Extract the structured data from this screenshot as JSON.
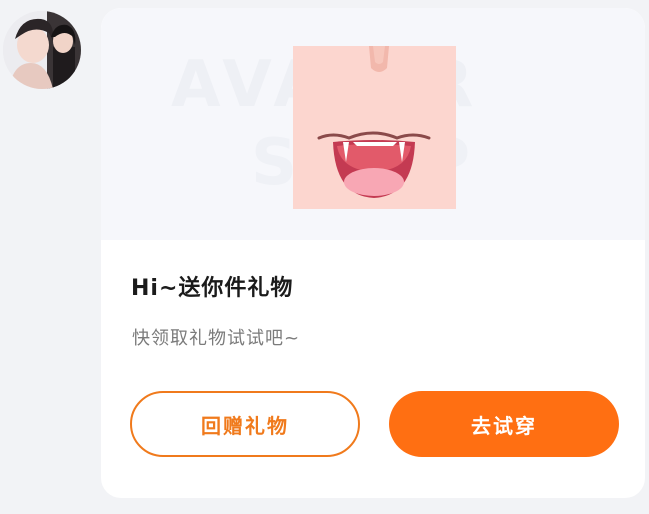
{
  "avatar": {
    "icon": "user-avatar-photo"
  },
  "card": {
    "banner": {
      "watermark_line1": "AVATAR",
      "watermark_line2": "SHOP",
      "image_icon": "vampire-fangs-mouth"
    },
    "title": "Hi~送你件礼物",
    "subtitle": "快领取礼物试试吧~",
    "buttons": {
      "return_gift_label": "回赠礼物",
      "try_on_label": "去试穿"
    }
  },
  "colors": {
    "accent": "#ff6f12",
    "outline": "#f07a1c",
    "image_bg": "#fcd6cf"
  }
}
